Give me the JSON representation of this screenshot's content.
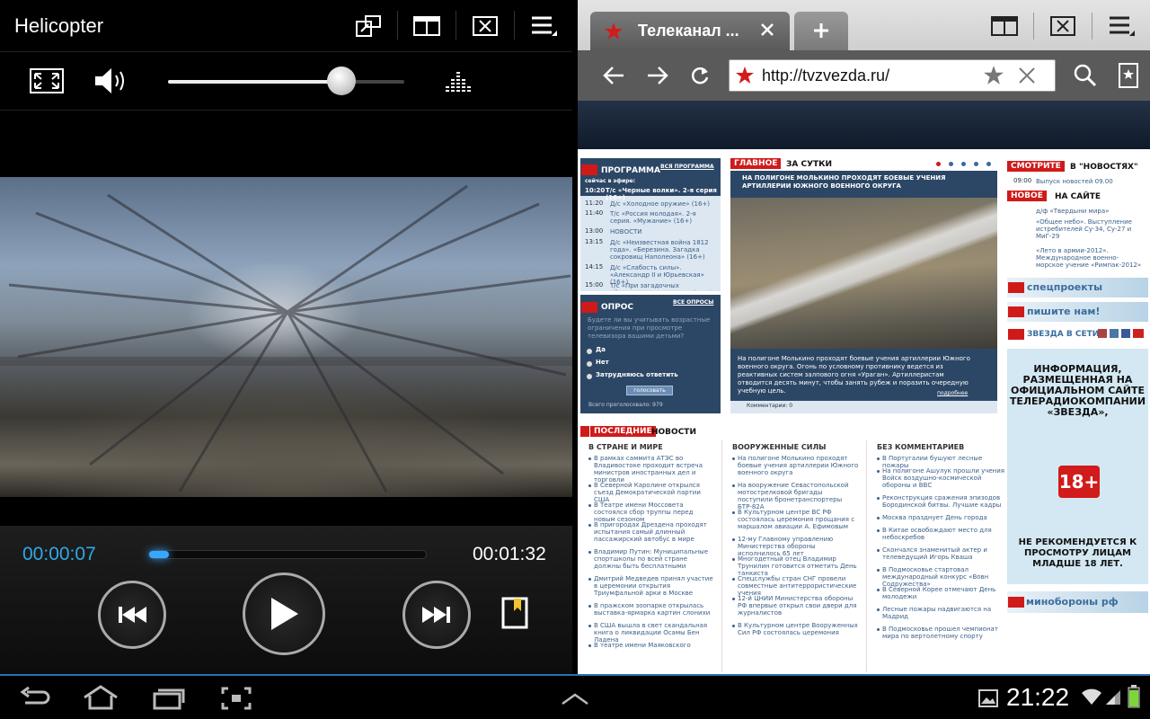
{
  "player": {
    "title": "Helicopter",
    "time_current": "00:00:07",
    "time_total": "00:01:32",
    "volume_level": 0.72,
    "progress": 0.08
  },
  "browser": {
    "tab_title": "Телеканал ...",
    "url": "http://tvzvezda.ru/",
    "site": {
      "programma": {
        "label": "ПРОГРАММА",
        "all": "ВСЯ ПРОГРАММА",
        "now": "сейчас в эфире:",
        "current": {
          "time": "10:20",
          "title": "Т/с «Черные волки». 2-я серия (16+)"
        },
        "items": [
          {
            "time": "11:20",
            "title": "Д/с «Холодное оружие» (16+)"
          },
          {
            "time": "11:40",
            "title": "Т/с «Россия молодая». 2-я серия. «Мужание» (16+)"
          },
          {
            "time": "13:00",
            "title": "НОВОСТИ"
          },
          {
            "time": "13:15",
            "title": "Д/с «Неизвестная война 1812 года». «Березина. Загадка сокровищ Наполеона» (16+)"
          },
          {
            "time": "14:15",
            "title": "Д/с «Слабость силы». «Александр II и Юрьевская» (16+)"
          },
          {
            "time": "15:00",
            "title": "Т/с «При загадочных обстоятельствах. Флер» (16+)"
          }
        ]
      },
      "opros": {
        "label": "ОПРОС",
        "all": "ВСЕ ОПРОСЫ",
        "question": "Будете ли вы учитывать возрастные ограничения при просмотре телевизора вашими детьми?",
        "options": [
          "Да",
          "Нет",
          "Затрудняюсь ответить"
        ],
        "button": "голосовать",
        "total": "Всего проголосовало: 979"
      },
      "glavnoe": {
        "tag": "ГЛАВНОЕ",
        "suffix": "ЗА СУТКИ",
        "headline": "НА ПОЛИГОНЕ МОЛЬКИНО ПРОХОДЯТ БОЕВЫЕ УЧЕНИЯ АРТИЛЛЕРИИ ЮЖНОГО ВОЕННОГО ОКРУГА",
        "caption": "На полигоне Молькино проходят боевые учения артиллерии Южного военного округа. Огонь по условному противнику ведется из реактивных систем залпового огня «Ураган». Артиллеристам отводится десять минут, чтобы занять рубеж и поразить очередную учебную цель.",
        "more": "подробнее",
        "comments": "Комментарии: 0"
      },
      "smotrite": {
        "tag": "СМОТРИТЕ",
        "suffix": "В \"НОВОСТЯХ\"",
        "time": "09:00",
        "item": "Выпуск новостей 09.00"
      },
      "novoe": {
        "tag": "НОВОЕ",
        "suffix": "НА САЙТЕ",
        "items": [
          "д/ф «Твердыни мира»",
          "«Общее небо». Выступление истребителей Су-34, Су-27 и МиГ-29",
          "«Лето в армии-2012». Международное военно-морское учение «Римпак-2012»"
        ]
      },
      "side_links": [
        "спецпроекты",
        "пишите нам!",
        "ЗВЕЗДА В СЕТИ"
      ],
      "ad": {
        "text": "ИНФОРМАЦИЯ, РАЗМЕЩЕННАЯ НА ОФИЦИАЛЬНОМ САЙТЕ ТЕЛЕРАДИОКОМПАНИИ «ЗВЕЗДА»,",
        "age": "18+",
        "warning": "НЕ РЕКОМЕНДУЕТСЯ К ПРОСМОТРУ ЛИЦАМ МЛАДШЕ 18 ЛЕТ."
      },
      "minoborony": "минобороны рф",
      "poslednie": {
        "tag": "ПОСЛЕДНИЕ",
        "suffix": "НОВОСТИ",
        "columns": [
          {
            "title": "В СТРАНЕ И МИРЕ",
            "items": [
              "В рамках саммита АТЭС во Владивостоке проходит встреча министров иностранных дел и торговли",
              "В Северной Каролине открылся съезд Демократической партии США",
              "В Театре имени Моссовета состоялся сбор труппы перед новым сезоном",
              "В пригородах Дрездена проходят испытания самый длинный пассажирский автобус в мире",
              "Владимир Путин: Муниципальные спортшколы по всей стране должны быть бесплатными",
              "Дмитрий Медведев принял участие в церемонии открытия Триумфальной арки в Москве",
              "В пражском зоопарке открылась выставка-ярмарка картин слонихи",
              "В США вышла в свет скандальная книга о ликвидации Осамы Бен Ладена",
              "В театре имени Маяковского"
            ]
          },
          {
            "title": "ВООРУЖЕННЫЕ СИЛЫ",
            "items": [
              "На полигоне Молькино проходят боевые учения артиллерии Южного военного округа",
              "На вооружение Севастопольской мотострелковой бригады поступили бронетранспортеры БТР-82А",
              "В Культурном центре ВС РФ состоялась церемония прощания с маршалом авиации А. Ефимовым",
              "12-му Главному управлению Министерства обороны исполнилось 65 лет",
              "Многодетный отец Владимир Трунилин готовится отметить День танкиста",
              "Спецслужбы стран СНГ провели совместные антитеррористические учения",
              "12-й ЦНИИ Министерства обороны РФ впервые открыл свои двери для журналистов",
              "В Культурном центре Вооруженных Сил РФ состоялась церемония"
            ]
          },
          {
            "title": "БЕЗ КОММЕНТАРИЕВ",
            "items": [
              "В Португалии бушуют лесные пожары",
              "На полигоне Ашулук прошли учения Войск воздушно-космической обороны и ВВС",
              "Реконструкция сражения эпизодов Бородинской битвы. Лучшие кадры",
              "Москва празднует День города",
              "В Китае освобождают место для небоскребов",
              "Скончался знаменитый актер и телеведущий Игорь Кваша",
              "В Подмосковье стартовал международный конкурс «Вовн Содружества»",
              "В Северной Корее отмечают День молодежи",
              "Лесные пожары надвигаются на Мадрид",
              "В Подмосковье прошел чемпионат мира по вертолетному спорту"
            ]
          }
        ]
      }
    }
  },
  "statusbar": {
    "time": "21:22"
  },
  "colors": {
    "accent_blue": "#31a8e6",
    "site_navy": "#2c4766",
    "site_red": "#d01a1a"
  }
}
